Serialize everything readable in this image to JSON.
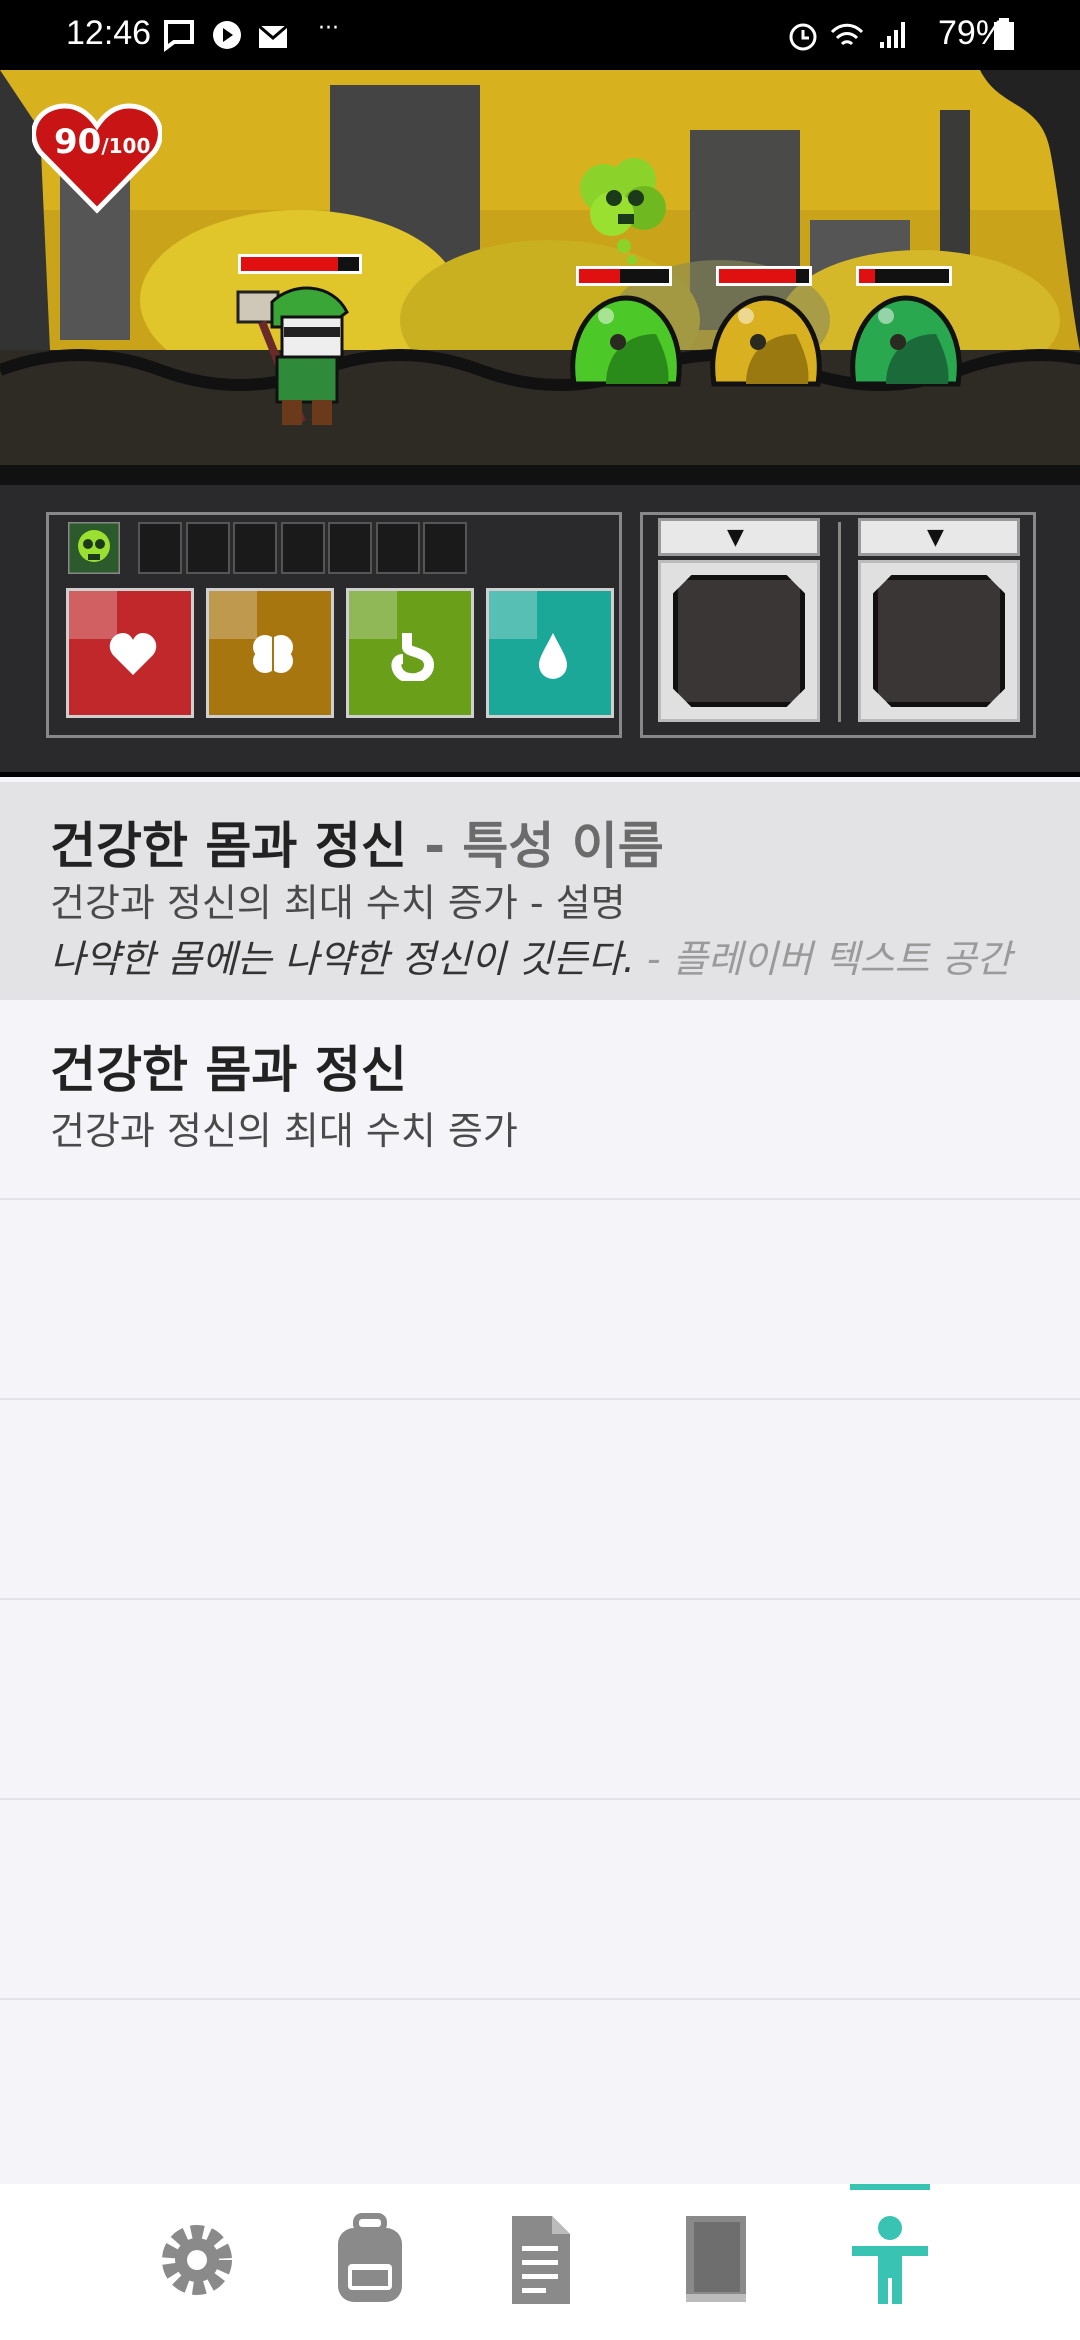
{
  "status_bar": {
    "time": "12:46",
    "battery": "79%",
    "more": "···"
  },
  "player": {
    "hp": "90",
    "hp_max": "/100",
    "health_bar": 0.82
  },
  "enemies": [
    {
      "name": "green-slime",
      "health": 0.45
    },
    {
      "name": "yellow-slime",
      "health": 0.85
    },
    {
      "name": "green-slime-2",
      "health": 0.18
    }
  ],
  "traits": [
    {
      "name": "건강한 몸과 정신",
      "name_suffix": " - 특성 이름",
      "desc": "건강과 정신의 최대 수치 증가",
      "desc_suffix": " - 설명",
      "flavor": "나약한 몸에는 나약한 정신이 깃든다.",
      "flavor_suffix": " - 플레이버 텍스트 공간",
      "selected": true
    },
    {
      "name": "건강한 몸과 정신",
      "desc": "건강과 정신의 최대 수치 증가",
      "selected": false
    }
  ],
  "stats": [
    {
      "icon": "heart-icon",
      "color": "#c0282b"
    },
    {
      "icon": "brain-icon",
      "color": "#a8760f"
    },
    {
      "icon": "stomach-icon",
      "color": "#6a9f1a"
    },
    {
      "icon": "water-drop-icon",
      "color": "#1ca898"
    }
  ],
  "dropdown_arrow": "▼",
  "nav": {
    "items": [
      "settings-icon",
      "backpack-icon",
      "document-icon",
      "book-icon",
      "person-icon"
    ],
    "active": 4,
    "accent": "#38c3b3"
  }
}
